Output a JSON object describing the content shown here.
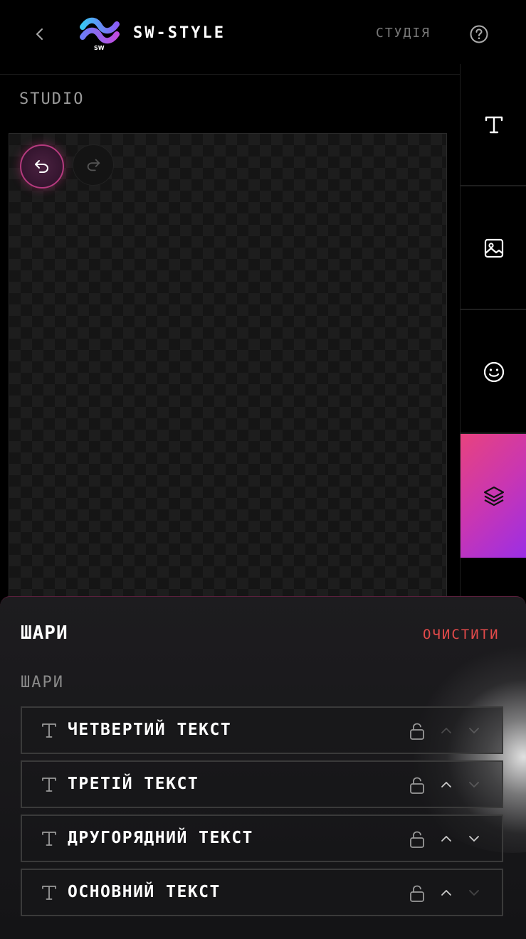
{
  "header": {
    "logo_badge": "SW",
    "brand": "SW-STYLE",
    "studio_link": "СТУДІЯ"
  },
  "studio": {
    "label": "STUDIO"
  },
  "toolbar": {
    "tools": [
      {
        "icon": "text-icon",
        "active": false
      },
      {
        "icon": "image-icon",
        "active": false
      },
      {
        "icon": "smiley-icon",
        "active": false
      },
      {
        "icon": "layers-icon",
        "active": true
      }
    ],
    "accent_gradient": [
      "#e8437e",
      "#9b2ee6"
    ]
  },
  "sheet": {
    "title": "ШАРИ",
    "clear_label": "ОЧИСТИТИ",
    "section_label": "ШАРИ",
    "layers": [
      {
        "name": "ЧЕТВЕРТИЙ ТЕКСТ",
        "up_enabled": false,
        "down_enabled": false
      },
      {
        "name": "ТРЕТІЙ ТЕКСТ",
        "up_enabled": true,
        "down_enabled": false
      },
      {
        "name": "ДРУГОРЯДНИЙ ТЕКСТ",
        "up_enabled": true,
        "down_enabled": true
      },
      {
        "name": "ОСНОВНИЙ ТЕКСТ",
        "up_enabled": true,
        "down_enabled": false
      }
    ]
  },
  "colors": {
    "clear": "#e24a4a",
    "undo_border": "#b53a7e"
  }
}
